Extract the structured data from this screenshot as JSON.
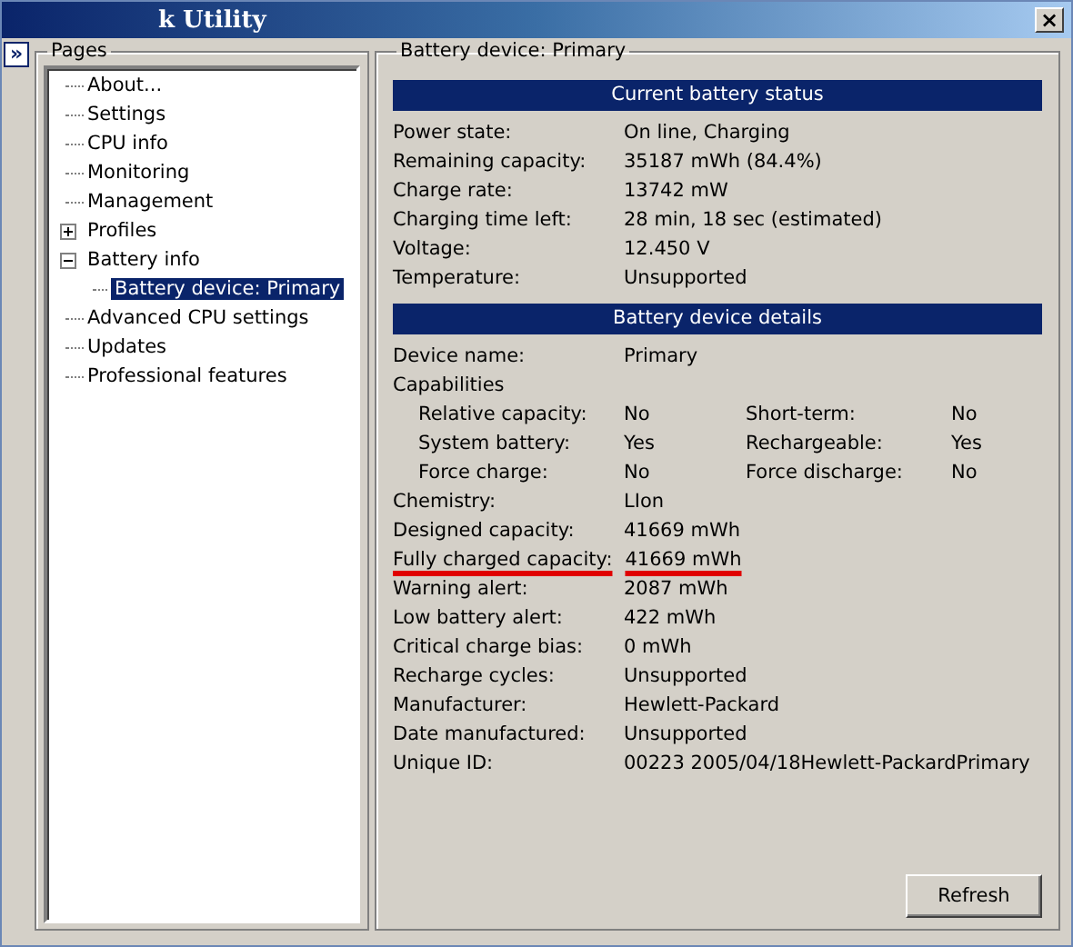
{
  "window": {
    "title": "k Utility",
    "close": "×"
  },
  "sidebar": {
    "toggle": "»",
    "title": "Pages",
    "items": [
      {
        "label": "About...",
        "selected": false
      },
      {
        "label": "Settings",
        "selected": false
      },
      {
        "label": "CPU info",
        "selected": false
      },
      {
        "label": "Monitoring",
        "selected": false
      },
      {
        "label": "Management",
        "selected": false
      },
      {
        "label": "Profiles",
        "selected": false,
        "expanded": false
      },
      {
        "label": "Battery info",
        "selected": false,
        "expanded": true,
        "children": [
          {
            "label": "Battery device: Primary",
            "selected": true
          }
        ]
      },
      {
        "label": "Advanced CPU settings",
        "selected": false
      },
      {
        "label": "Updates",
        "selected": false
      },
      {
        "label": "Professional features",
        "selected": false
      }
    ]
  },
  "panel": {
    "title": "Battery device: Primary",
    "sections": [
      {
        "heading": "Current battery status",
        "rows": [
          {
            "kind": "pair",
            "label": "Power state:",
            "value": "On line, Charging"
          },
          {
            "kind": "pair",
            "label": "Remaining capacity:",
            "value": "35187 mWh (84.4%)"
          },
          {
            "kind": "pair",
            "label": "Charge rate:",
            "value": "13742 mW"
          },
          {
            "kind": "pair",
            "label": "Charging time left:",
            "value": "28 min, 18 sec (estimated)"
          },
          {
            "kind": "pair",
            "label": "Voltage:",
            "value": "12.450 V"
          },
          {
            "kind": "pair",
            "label": "Temperature:",
            "value": "Unsupported"
          }
        ]
      },
      {
        "heading": "Battery device details",
        "rows": [
          {
            "kind": "pair",
            "label": "Device name:",
            "value": "Primary"
          },
          {
            "kind": "caption",
            "label": "Capabilities"
          },
          {
            "kind": "quad",
            "label": "Relative capacity:",
            "value": "No",
            "label2": "Short-term:",
            "value2": "No"
          },
          {
            "kind": "quad",
            "label": "System battery:",
            "value": "Yes",
            "label2": "Rechargeable:",
            "value2": "Yes"
          },
          {
            "kind": "quad",
            "label": "Force charge:",
            "value": "No",
            "label2": "Force discharge:",
            "value2": "No"
          },
          {
            "kind": "pair",
            "label": "Chemistry:",
            "value": "LIon"
          },
          {
            "kind": "pair",
            "label": "Designed capacity:",
            "value": "41669 mWh"
          },
          {
            "kind": "pair",
            "label": "Fully charged capacity:",
            "value": "41669 mWh",
            "underlined": true
          },
          {
            "kind": "pair",
            "label": "Warning alert:",
            "value": "2087 mWh"
          },
          {
            "kind": "pair",
            "label": "Low battery alert:",
            "value": "422 mWh"
          },
          {
            "kind": "pair",
            "label": "Critical charge bias:",
            "value": "0 mWh"
          },
          {
            "kind": "pair",
            "label": "Recharge cycles:",
            "value": "Unsupported"
          },
          {
            "kind": "pair",
            "label": "Manufacturer:",
            "value": "Hewlett-Packard"
          },
          {
            "kind": "pair",
            "label": "Date manufactured:",
            "value": "Unsupported"
          },
          {
            "kind": "pair",
            "label": "Unique ID:",
            "value": "00223 2005/04/18Hewlett-PackardPrimary"
          }
        ]
      }
    ],
    "button": "Refresh"
  }
}
